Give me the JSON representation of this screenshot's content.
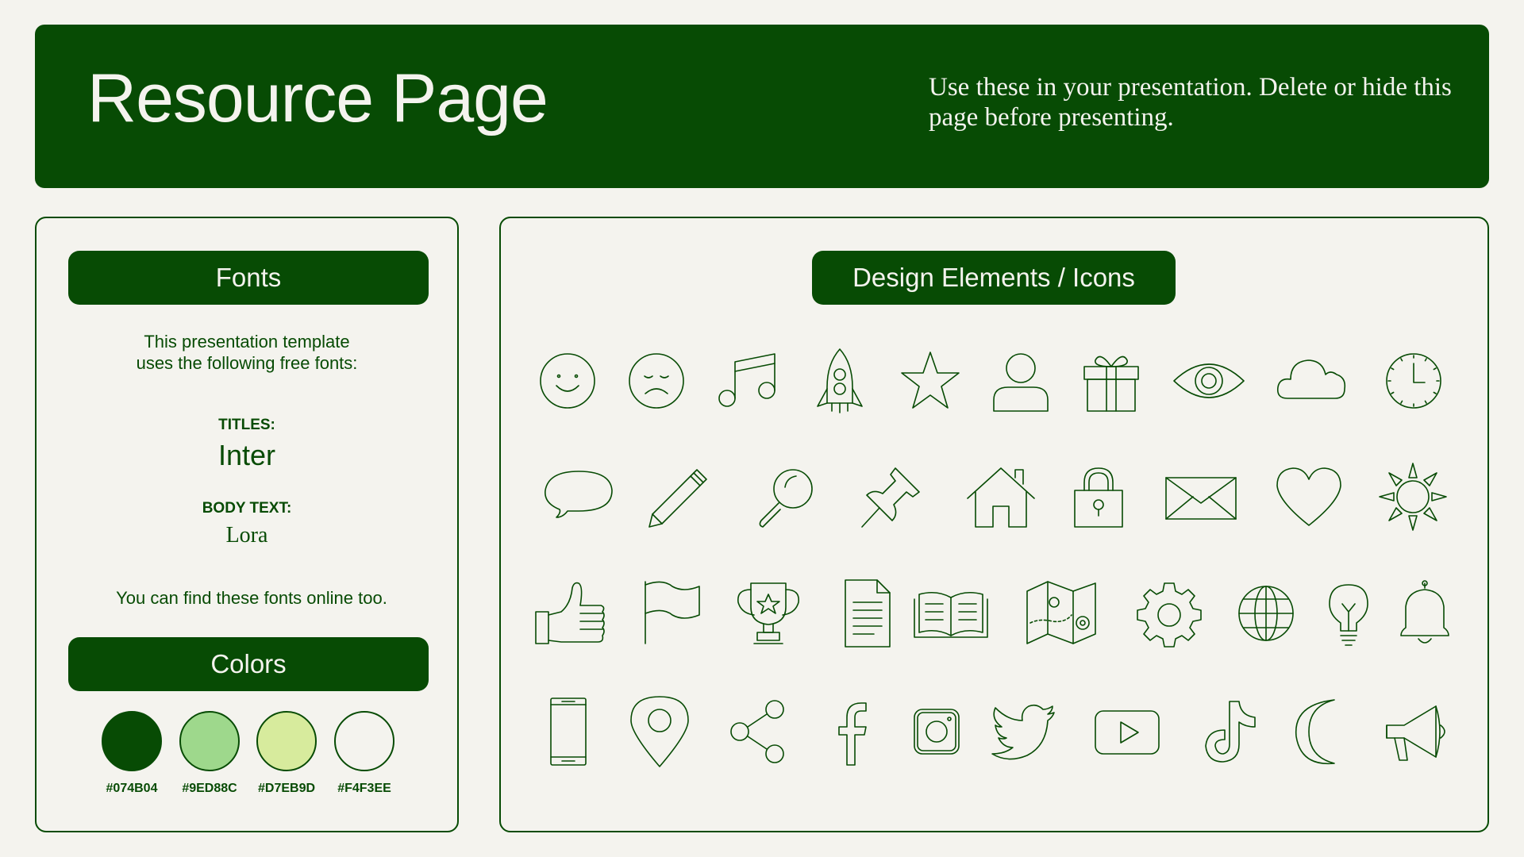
{
  "header": {
    "title": "Resource Page",
    "subtitle": "Use these in your presentation. Delete or hide this page before presenting."
  },
  "fonts_panel": {
    "heading": "Fonts",
    "intro_line1": "This presentation template",
    "intro_line2": "uses the following free fonts:",
    "titles_label": "TITLES:",
    "titles_font": "Inter",
    "body_label": "BODY TEXT:",
    "body_font": "Lora",
    "footer": "You can find these fonts online too."
  },
  "colors_panel": {
    "heading": "Colors",
    "swatches": [
      {
        "hex": "#074B04",
        "label": "#074B04"
      },
      {
        "hex": "#9ED88C",
        "label": "#9ED88C"
      },
      {
        "hex": "#D7EB9D",
        "label": "#D7EB9D"
      },
      {
        "hex": "#F4F3EE",
        "label": "#F4F3EE"
      }
    ]
  },
  "icons_panel": {
    "heading": "Design Elements / Icons",
    "icons": [
      "smile-icon",
      "sad-icon",
      "music-note-icon",
      "rocket-icon",
      "star-icon",
      "user-icon",
      "gift-icon",
      "eye-icon",
      "cloud-icon",
      "clock-icon",
      "speech-bubble-icon",
      "pencil-icon",
      "magnifier-icon",
      "pushpin-icon",
      "house-icon",
      "padlock-icon",
      "envelope-icon",
      "heart-icon",
      "sun-icon",
      "thumbs-up-icon",
      "flag-icon",
      "trophy-icon",
      "document-icon",
      "open-book-icon",
      "map-icon",
      "gear-icon",
      "globe-icon",
      "lightbulb-icon",
      "bell-icon",
      "smartphone-icon",
      "location-pin-icon",
      "share-icon",
      "facebook-icon",
      "instagram-icon",
      "twitter-icon",
      "youtube-icon",
      "tiktok-icon",
      "moon-icon",
      "megaphone-icon"
    ]
  }
}
